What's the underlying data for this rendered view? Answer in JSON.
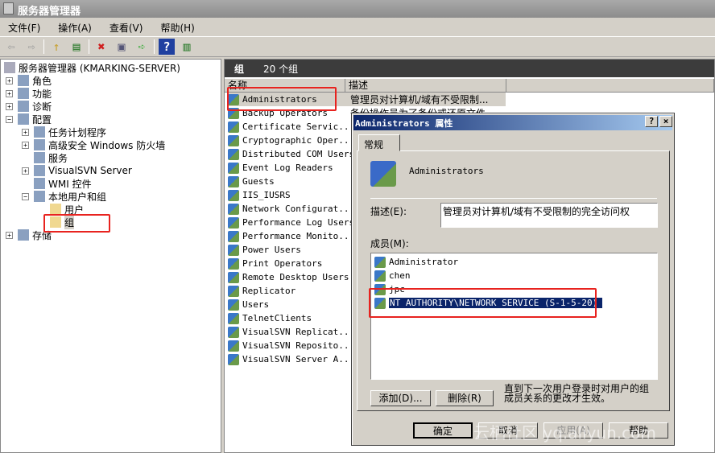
{
  "window": {
    "title": "服务器管理器"
  },
  "menu": [
    "文件(F)",
    "操作(A)",
    "查看(V)",
    "帮助(H)"
  ],
  "toolbar": [
    "back-icon",
    "forward-icon",
    "up-icon",
    "show-hide-tree-icon",
    "delete-icon",
    "properties-icon",
    "export-icon",
    "help-icon",
    "action-pane-icon"
  ],
  "tree": {
    "root": "服务器管理器 (KMARKING-SERVER)",
    "items": [
      {
        "label": "角色",
        "expander": "+"
      },
      {
        "label": "功能",
        "expander": "+"
      },
      {
        "label": "诊断",
        "expander": "+"
      },
      {
        "label": "配置",
        "expander": "-"
      },
      {
        "label": "任务计划程序",
        "expander": "+"
      },
      {
        "label": "高级安全 Windows 防火墙",
        "expander": "+"
      },
      {
        "label": "服务",
        "expander": ""
      },
      {
        "label": "VisualSVN Server",
        "expander": "+"
      },
      {
        "label": "WMI 控件",
        "expander": ""
      },
      {
        "label": "本地用户和组",
        "expander": "-"
      },
      {
        "label": "用户",
        "expander": ""
      },
      {
        "label": "组",
        "expander": "",
        "selected": true
      },
      {
        "label": "存储",
        "expander": "+"
      }
    ]
  },
  "list": {
    "title": "组",
    "count": "20 个组",
    "columns": [
      "名称",
      "描述"
    ],
    "rows": [
      {
        "name": "Administrators",
        "desc": "管理员对计算机/域有不受限制..."
      },
      {
        "name": "Backup Operators",
        "desc": "备份操作员为了备份或还原文件..."
      },
      {
        "name": "Certificate Servic..."
      },
      {
        "name": "Cryptographic Oper..."
      },
      {
        "name": "Distributed COM Users"
      },
      {
        "name": "Event Log Readers"
      },
      {
        "name": "Guests"
      },
      {
        "name": "IIS_IUSRS"
      },
      {
        "name": "Network Configurat..."
      },
      {
        "name": "Performance Log Users"
      },
      {
        "name": "Performance Monito..."
      },
      {
        "name": "Power Users"
      },
      {
        "name": "Print Operators"
      },
      {
        "name": "Remote Desktop Users"
      },
      {
        "name": "Replicator"
      },
      {
        "name": "Users"
      },
      {
        "name": "TelnetClients"
      },
      {
        "name": "VisualSVN Replicat..."
      },
      {
        "name": "VisualSVN Reposito..."
      },
      {
        "name": "VisualSVN Server A..."
      }
    ]
  },
  "dialog": {
    "title": "Administrators 属性",
    "help": "?",
    "close": "×",
    "tab": "常规",
    "group_name": "Administrators",
    "desc_label": "描述(E):",
    "desc_value": "管理员对计算机/域有不受限制的完全访问权",
    "members_label": "成员(M):",
    "members": [
      {
        "name": "Administrator"
      },
      {
        "name": "chen"
      },
      {
        "name": "jpc"
      },
      {
        "name": "NT AUTHORITY\\NETWORK SERVICE (S-1-5-20)",
        "selected": true
      }
    ],
    "add": "添加(D)...",
    "remove": "删除(R)",
    "note": "直到下一次用户登录时对用户的组成员关系的更改才生效。",
    "ok": "确定",
    "cancel": "取消",
    "apply": "应用(A)",
    "help_btn": "帮助"
  },
  "watermark": "云栖社区 yq.aliyun.com",
  "colors": {
    "highlight": "#e8231f",
    "selection": "#0a246a"
  }
}
